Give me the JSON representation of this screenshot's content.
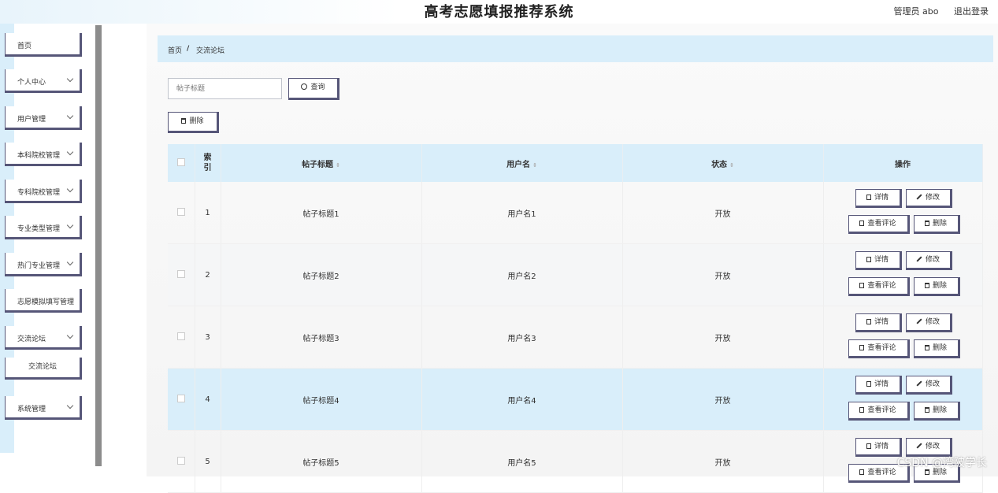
{
  "app": {
    "title": "高考志愿填报推荐系统"
  },
  "topbar": {
    "user": "管理员 abo",
    "logout": "退出登录"
  },
  "sidebar": {
    "items": [
      {
        "label": "首页",
        "has_chevron": false
      },
      {
        "label": "个人中心",
        "has_chevron": true
      },
      {
        "label": "用户管理",
        "has_chevron": true
      },
      {
        "label": "本科院校管理",
        "has_chevron": true
      },
      {
        "label": "专科院校管理",
        "has_chevron": true
      },
      {
        "label": "专业类型管理",
        "has_chevron": true
      },
      {
        "label": "热门专业管理",
        "has_chevron": true
      },
      {
        "label": "志愿模拟填写管理",
        "has_chevron": false
      },
      {
        "label": "交流论坛",
        "has_chevron": true
      },
      {
        "label": "系统管理",
        "has_chevron": true
      }
    ],
    "sub_item": "交流论坛"
  },
  "breadcrumb": {
    "home": "首页",
    "separator": "/",
    "current": "交流论坛"
  },
  "search": {
    "placeholder": "帖子标题",
    "button": "查询"
  },
  "toolbar": {
    "delete": "删除"
  },
  "table": {
    "headers": {
      "index": "索引",
      "title": "帖子标题",
      "user": "用户名",
      "status": "状态",
      "ops": "操作"
    },
    "rows": [
      {
        "index": "1",
        "title": "帖子标题1",
        "user": "用户名1",
        "status": "开放"
      },
      {
        "index": "2",
        "title": "帖子标题2",
        "user": "用户名2",
        "status": "开放"
      },
      {
        "index": "3",
        "title": "帖子标题3",
        "user": "用户名3",
        "status": "开放"
      },
      {
        "index": "4",
        "title": "帖子标题4",
        "user": "用户名4",
        "status": "开放"
      },
      {
        "index": "5",
        "title": "帖子标题5",
        "user": "用户名5",
        "status": "开放"
      }
    ],
    "actions": {
      "detail": "详情",
      "edit": "修改",
      "comments": "查看评论",
      "delete": "删除"
    }
  },
  "watermark": "CSDN @湾陂学长",
  "colors": {
    "accent": "#d9eefa",
    "button_border": "#565678"
  }
}
